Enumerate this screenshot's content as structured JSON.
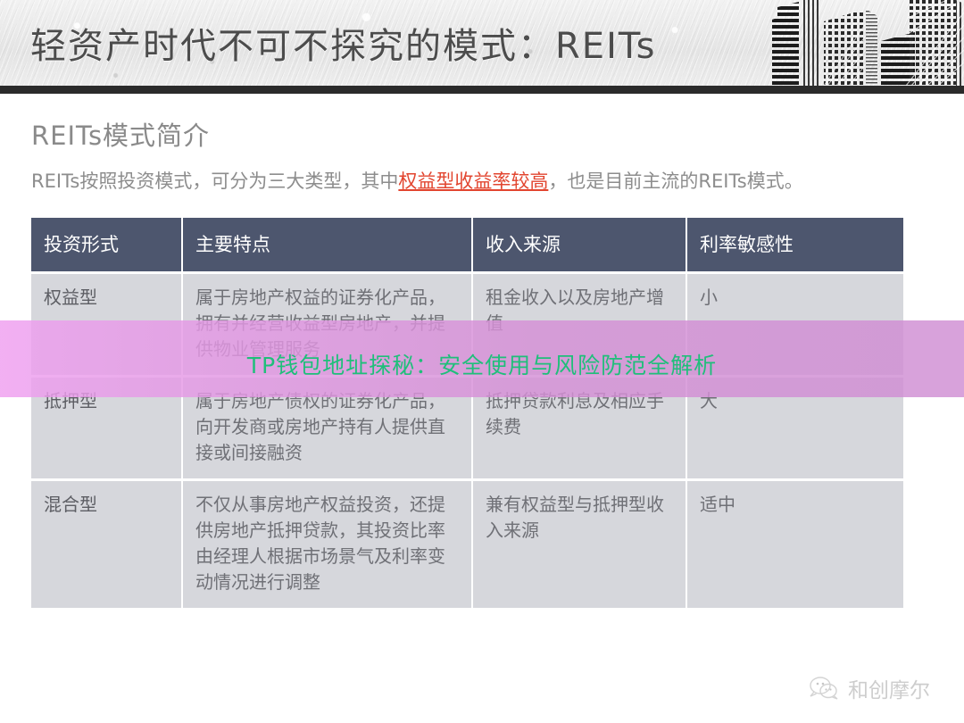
{
  "header": {
    "title": "轻资产时代不可不探究的模式：REITs",
    "graphic": "skyscrapers-illustration"
  },
  "section": {
    "title": "REITs模式简介",
    "intro_before": "REITs按照投资模式，可分为三大类型，其中",
    "intro_highlight": "权益型收益率较高",
    "intro_after": "，也是目前主流的REITs模式。",
    "highlight_color": "#e2452f"
  },
  "table": {
    "header_bg": "#4d566e",
    "row_bg": "#d6d7dc",
    "columns": [
      "投资形式",
      "主要特点",
      "收入来源",
      "利率敏感性"
    ],
    "rows": [
      {
        "type": "权益型",
        "features": "属于房地产权益的证券化产品，拥有并经营收益型房地产，并提供物业管理服务",
        "income": "租金收入以及房地产增值",
        "sensitivity": "小"
      },
      {
        "type": "抵押型",
        "features": "属于房地产债权的证券化产品，向开发商或房地产持有人提供直接或间接融资",
        "income": "抵押贷款利息及相应手续费",
        "sensitivity": "大"
      },
      {
        "type": "混合型",
        "features": "不仅从事房地产权益投资，还提供房地产抵押贷款，其投资比率由经理人根据市场景气及利率变动情况进行调整",
        "income": "兼有权益型与抵押型收入来源",
        "sensitivity": "适中"
      }
    ]
  },
  "overlay": {
    "text": "TP钱包地址探秘：安全使用与风险防范全解析",
    "text_color": "#1fbf7a",
    "band_color": "#e79ae8"
  },
  "footer": {
    "logo_icon": "wechat-icon",
    "brand": "和创摩尔"
  }
}
